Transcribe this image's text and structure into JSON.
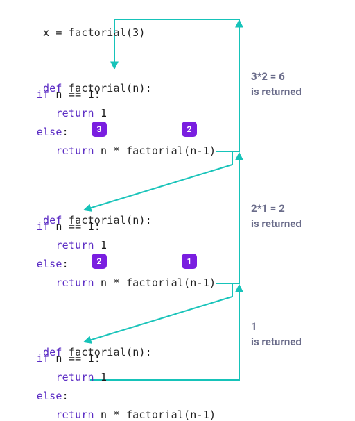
{
  "colors": {
    "arrow": "#16c3b9",
    "badge": "#7a1ee0"
  },
  "call_line": "x = factorial(3)",
  "code_block": {
    "l1": "def factorial(n):",
    "l2": "   if n == 1:",
    "l3": "      return 1",
    "l4": "   else:",
    "l5": "      return n * factorial(n-1)"
  },
  "tokens": {
    "def": "def",
    "if": "if",
    "else": "else",
    "return": "return",
    "factorial": "factorial",
    "n": "n",
    "one": "1",
    "eq": "==",
    "times": "*",
    "nminus1": "(n-1)",
    "colon": ":",
    "assign": "x = ",
    "three": "(3)"
  },
  "badges": {
    "block1_n": "3",
    "block1_arg": "2",
    "block2_n": "2",
    "block2_arg": "1"
  },
  "annotations": {
    "ret1_a": "3*2 = 6",
    "ret1_b": "is returned",
    "ret2_a": "2*1 = 2",
    "ret2_b": "is returned",
    "ret3_a": "1",
    "ret3_b": "is returned"
  }
}
